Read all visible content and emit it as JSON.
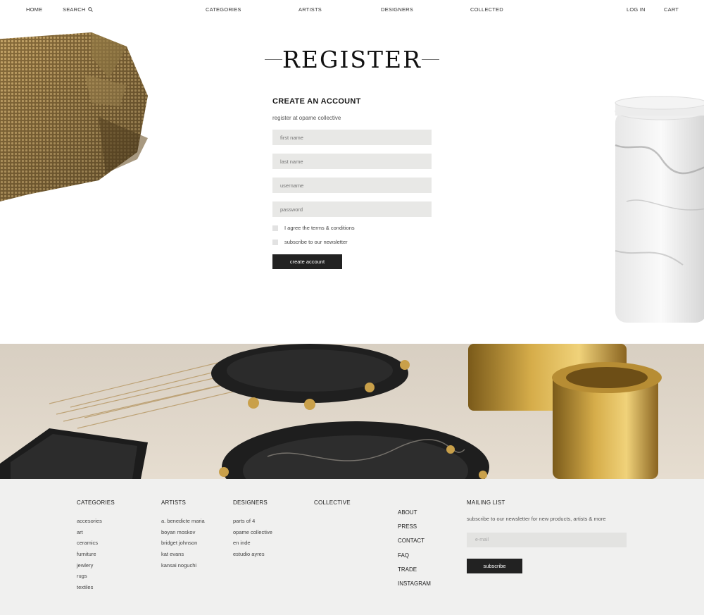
{
  "nav": {
    "home": "HOME",
    "search": "SEARCH",
    "categories": "CATEGORIES",
    "artists": "ARTISTS",
    "designers": "DESIGNERS",
    "collected": "COLLECTED",
    "login": "LOG IN",
    "cart": "CART"
  },
  "hero": {
    "title": "REGISTER"
  },
  "form": {
    "heading": "CREATE AN ACCOUNT",
    "subheading": "register at opame collective",
    "first_name_placeholder": "first name",
    "last_name_placeholder": "last name",
    "username_placeholder": "username",
    "password_placeholder": "password",
    "agree_label": "I agree the terms & conditions",
    "newsletter_label": "subscribe to our newsletter",
    "submit_label": "create account"
  },
  "footer": {
    "categories": {
      "heading": "CATEGORIES",
      "items": [
        "accesories",
        "art",
        "ceramics",
        "furniture",
        "jewlery",
        "rugs",
        "textiles"
      ]
    },
    "artists": {
      "heading": "ARTISTS",
      "items": [
        "a. benedicte maria",
        "boyan moskov",
        "bridget johnson",
        "kat evans",
        "kansai noguchi"
      ]
    },
    "designers": {
      "heading": "DESIGNERS",
      "items": [
        "parts of 4",
        "opame collective",
        "en inde",
        "estudio ayres"
      ]
    },
    "collective": {
      "heading": "COLLECTIVE"
    },
    "about": {
      "items": [
        "ABOUT",
        "PRESS",
        "CONTACT",
        "FAQ",
        "TRADE",
        "INSTAGRAM"
      ]
    },
    "mailing": {
      "heading": "MAILING LIST",
      "description": "subscribe to our newsletter for new products, artists & more",
      "email_placeholder": "e-mail",
      "button_label": "subscribe"
    }
  },
  "colors": {
    "dark_button": "#222222",
    "input_bg": "#e8e8e6",
    "footer_bg": "#f0f0ef"
  },
  "icons": {
    "search": "search-icon"
  }
}
